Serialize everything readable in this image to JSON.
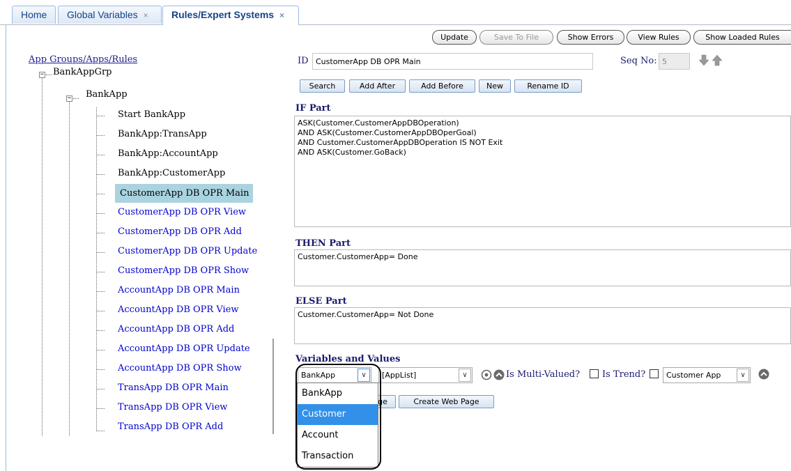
{
  "tabs": [
    {
      "label": "Home",
      "closable": false,
      "active": false
    },
    {
      "label": "Global Variables",
      "closable": true,
      "active": false
    },
    {
      "label": "Rules/Expert Systems",
      "closable": true,
      "active": true
    }
  ],
  "tab_close_glyph": "×",
  "toolbar": {
    "update": "Update",
    "save_to_file": "Save To File",
    "show_errors": "Show Errors",
    "view_rules": "View Rules",
    "show_loaded_rules": "Show Loaded Rules"
  },
  "tree": {
    "root_label": "App Groups/Apps/Rules",
    "group_label": "BankAppGrp",
    "app_label": "BankApp",
    "rules": [
      {
        "label": "Start BankApp",
        "style": "black"
      },
      {
        "label": "BankApp:TransApp",
        "style": "black"
      },
      {
        "label": "BankApp:AccountApp",
        "style": "black"
      },
      {
        "label": "BankApp:CustomerApp",
        "style": "black"
      },
      {
        "label": "CustomerApp DB OPR Main",
        "style": "selected"
      },
      {
        "label": "CustomerApp DB OPR View",
        "style": "blue"
      },
      {
        "label": "CustomerApp DB OPR Add",
        "style": "blue"
      },
      {
        "label": "CustomerApp DB OPR Update",
        "style": "blue"
      },
      {
        "label": "CustomerApp DB OPR Show",
        "style": "blue"
      },
      {
        "label": "AccountApp DB OPR Main",
        "style": "blue"
      },
      {
        "label": "AccountApp DB OPR View",
        "style": "blue"
      },
      {
        "label": "AccountApp DB OPR Add",
        "style": "blue"
      },
      {
        "label": "AccountApp DB OPR Update",
        "style": "blue"
      },
      {
        "label": "AccountApp DB OPR Show",
        "style": "blue"
      },
      {
        "label": "TransApp DB OPR Main",
        "style": "blue"
      },
      {
        "label": "TransApp DB OPR View",
        "style": "blue"
      },
      {
        "label": "TransApp DB OPR Add",
        "style": "blue"
      }
    ]
  },
  "form": {
    "id_label": "ID",
    "id_value": "CustomerApp DB OPR Main",
    "seq_label": "Seq No:",
    "seq_value": "5",
    "buttons": {
      "search": "Search",
      "add_after": "Add After",
      "add_before": "Add Before",
      "new": "New",
      "rename_id": "Rename ID"
    },
    "if_label": "IF Part",
    "if_text": "ASK(Customer.CustomerAppDBOperation)\nAND ASK(Customer.CustomerAppDBOperGoal)\nAND Customer.CustomerAppDBOperation IS NOT Exit\nAND ASK(Customer.GoBack)",
    "then_label": "THEN Part",
    "then_text": "Customer.CustomerApp= Done",
    "else_label": "ELSE Part",
    "else_text": "Customer.CustomerApp= Not Done",
    "vars_label": "Variables and Values",
    "var_group_value": "BankApp",
    "var_list_value": "[AppList]",
    "multi_valued_label": "Is Multi-Valued?",
    "trend_label": "Is Trend?",
    "app_select_value": "Customer App",
    "page_btn_partial": "ge",
    "create_web_page": "Create Web Page"
  },
  "dropdown": {
    "options": [
      "BankApp",
      "Customer",
      "Account",
      "Transaction"
    ],
    "highlighted": "Customer"
  },
  "colors": {
    "selected_rule_bg": "#a9d3df",
    "link_blue": "#0000cc",
    "dropdown_highlight": "#3390e8",
    "tab_border": "#99bbe8"
  },
  "icons": {
    "move_down": "arrow-down-icon",
    "move_up": "arrow-up-icon",
    "refresh": "refresh-icon",
    "collapse_up": "chevron-up-circle-icon"
  }
}
